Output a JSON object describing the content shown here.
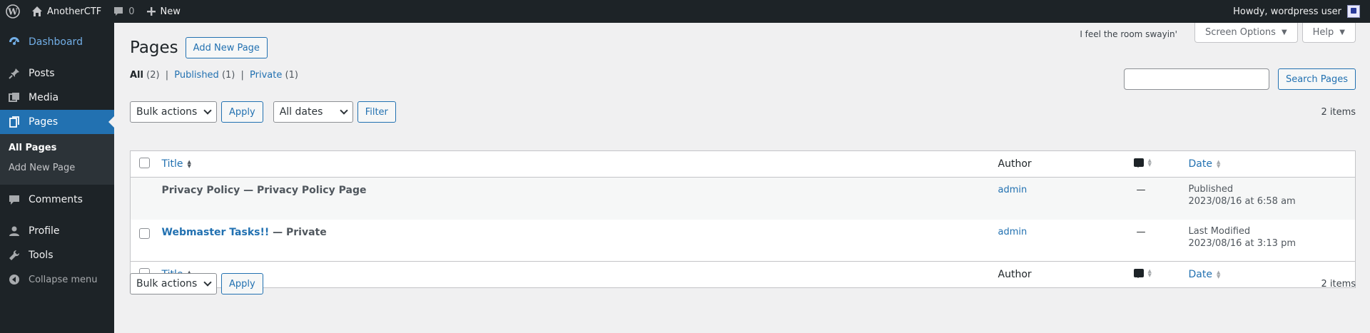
{
  "adminbar": {
    "site_name": "AnotherCTF",
    "comments_count": "0",
    "new_label": "New",
    "howdy": "Howdy, wordpress user"
  },
  "menu": {
    "items": [
      {
        "label": "Dashboard",
        "icon": "dashboard-icon"
      },
      {
        "label": "Posts",
        "icon": "pin-icon"
      },
      {
        "label": "Media",
        "icon": "media-icon"
      },
      {
        "label": "Pages",
        "icon": "pages-icon"
      },
      {
        "label": "Comments",
        "icon": "comment-icon"
      },
      {
        "label": "Profile",
        "icon": "user-icon"
      },
      {
        "label": "Tools",
        "icon": "wrench-icon"
      },
      {
        "label": "Collapse menu",
        "icon": "collapse-icon"
      }
    ],
    "submenu": [
      "All Pages",
      "Add New Page"
    ]
  },
  "top": {
    "lyrics": "I feel the room swayin'",
    "screen_options": "Screen Options",
    "help": "Help"
  },
  "heading": {
    "title": "Pages",
    "add_new": "Add New Page"
  },
  "views": {
    "all": "All",
    "all_count": "(2)",
    "published": "Published",
    "published_count": "(1)",
    "private": "Private",
    "private_count": "(1)",
    "sep": "|"
  },
  "search": {
    "value": "",
    "button": "Search Pages"
  },
  "tablenav": {
    "bulk": "Bulk actions",
    "apply": "Apply",
    "dates": "All dates",
    "filter": "Filter",
    "items": "2 items"
  },
  "table": {
    "columns": {
      "title": "Title",
      "author": "Author",
      "date": "Date"
    },
    "rows": [
      {
        "title": "Privacy Policy",
        "state": " — Privacy Policy Page",
        "author": "admin",
        "comments": "—",
        "date_status": "Published",
        "date": "2023/08/16 at 6:58 am"
      },
      {
        "title": "Webmaster Tasks!!",
        "state": " — Private",
        "author": "admin",
        "comments": "—",
        "date_status": "Last Modified",
        "date": "2023/08/16 at 3:13 pm"
      }
    ]
  }
}
